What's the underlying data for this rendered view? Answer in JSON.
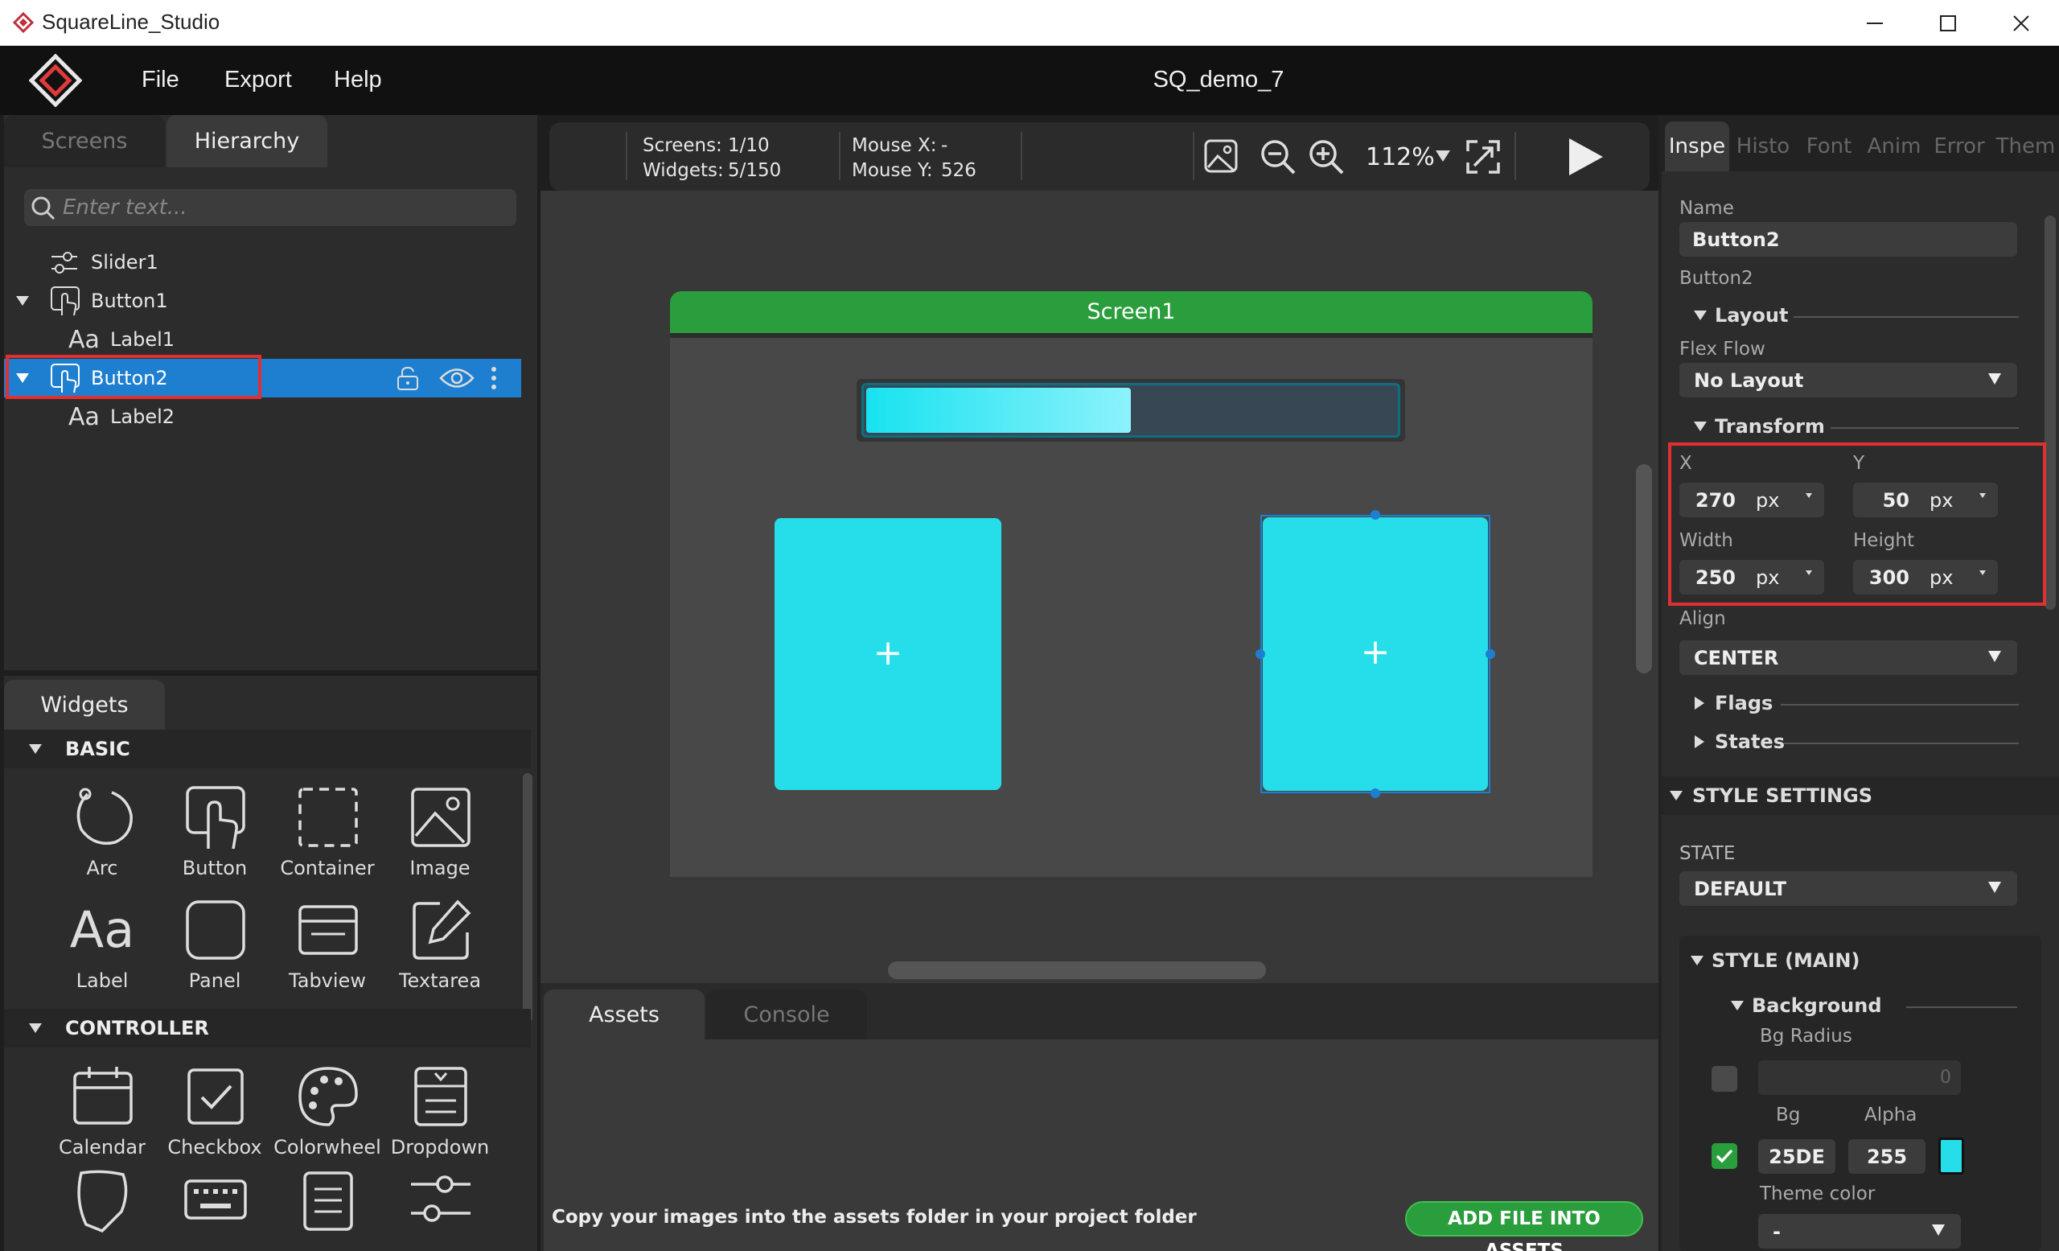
{
  "window": {
    "title": "SquareLine_Studio"
  },
  "menu": {
    "items": [
      "File",
      "Export",
      "Help"
    ],
    "project_title": "SQ_demo_7"
  },
  "left_tabs": {
    "screens": "Screens",
    "hierarchy": "Hierarchy"
  },
  "search": {
    "placeholder": "Enter text..."
  },
  "hierarchy": [
    {
      "label": "Slider1",
      "icon": "slider-icon"
    },
    {
      "label": "Button1",
      "icon": "button-icon"
    },
    {
      "label": "Label1",
      "icon": "label-icon"
    },
    {
      "label": "Button2",
      "icon": "button-icon",
      "selected": true
    },
    {
      "label": "Label2",
      "icon": "label-icon"
    }
  ],
  "widgets": {
    "tab": "Widgets",
    "sections": [
      "BASIC",
      "CONTROLLER"
    ],
    "basic": [
      "Arc",
      "Button",
      "Container",
      "Image",
      "Label",
      "Panel",
      "Tabview",
      "Textarea"
    ],
    "controller": [
      "Calendar",
      "Checkbox",
      "Colorwheel",
      "Dropdown"
    ]
  },
  "toolbar": {
    "screens_label": "Screens:",
    "screens_value": "1/10",
    "widgets_label": "Widgets:",
    "widgets_value": "5/150",
    "mouse_x_label": "Mouse X:",
    "mouse_x_value": "-",
    "mouse_y_label": "Mouse Y:",
    "mouse_y_value": "526",
    "zoom": "112%"
  },
  "canvas": {
    "screen_name": "Screen1",
    "slider_value": 0.5,
    "button_glyph": "+"
  },
  "bottom": {
    "tabs": [
      "Assets",
      "Console"
    ],
    "hint": "Copy your images into the assets folder in your project folder",
    "add_button": "ADD FILE INTO ASSETS"
  },
  "inspector": {
    "tabs": [
      "Inspe",
      "Histo",
      "Font",
      "Anim",
      "Error",
      "Them"
    ],
    "name_label": "Name",
    "name_value": "Button2",
    "type_label": "Button2",
    "layout_hdr": "Layout",
    "flex_label": "Flex Flow",
    "flex_value": "No Layout",
    "transform_hdr": "Transform",
    "x_label": "X",
    "x_value": "270",
    "y_label": "Y",
    "y_value": "50",
    "width_label": "Width",
    "width_value": "250",
    "height_label": "Height",
    "height_value": "300",
    "unit": "px",
    "align_label": "Align",
    "align_value": "CENTER",
    "flags_hdr": "Flags",
    "states_hdr": "States",
    "style_settings_hdr": "STYLE SETTINGS",
    "state_label": "STATE",
    "state_value": "DEFAULT",
    "style_main_hdr": "STYLE (MAIN)",
    "background_hdr": "Background",
    "bg_radius_label": "Bg Radius",
    "bg_radius_value": "0",
    "bg_label": "Bg",
    "bg_value": "25DE",
    "alpha_label": "Alpha",
    "alpha_value": "255",
    "theme_color_label": "Theme color",
    "theme_color_value": "-"
  },
  "colors": {
    "accent_blue": "#1e7fd0",
    "screen_green": "#2a9d3d",
    "button_cyan": "#25dee9",
    "highlight_red": "#e03030"
  }
}
